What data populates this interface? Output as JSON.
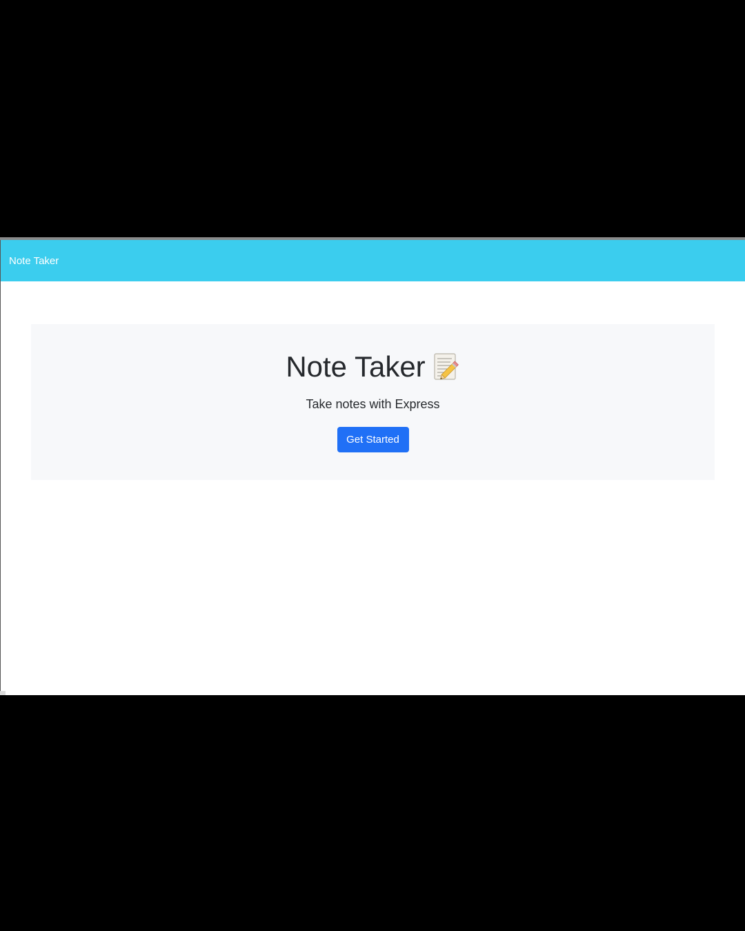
{
  "navbar": {
    "brand": "Note Taker",
    "background_color": "#3bcdee"
  },
  "hero": {
    "title": "Note Taker",
    "title_icon": "memo-pencil-icon",
    "subtitle": "Take notes with Express",
    "cta_label": "Get Started",
    "cta_color": "#2070f6",
    "background_color": "#f7f8fa"
  }
}
